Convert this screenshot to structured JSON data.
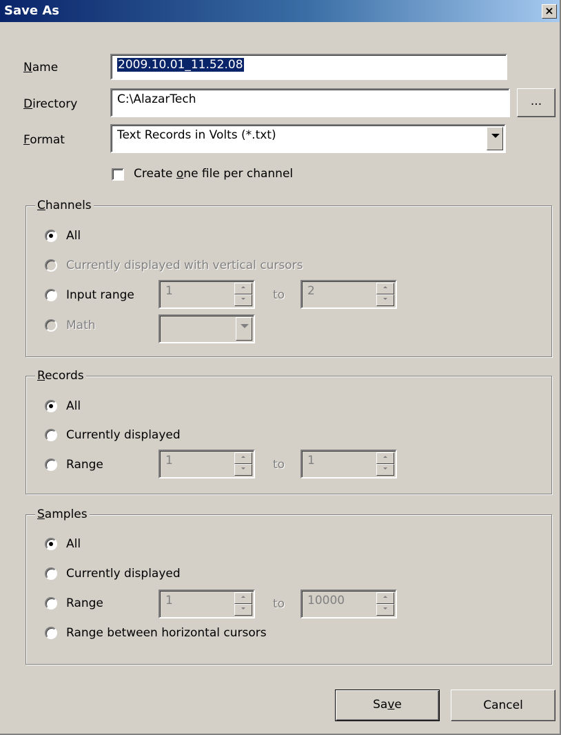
{
  "window": {
    "title": "Save As",
    "close_glyph": "×",
    "close_icon": "close-icon"
  },
  "name": {
    "label_key": "N",
    "label_rest": "ame",
    "value": "2009.10.01_11.52.08"
  },
  "directory": {
    "label_key": "D",
    "label_rest": "irectory",
    "value": "C:\\AlazarTech",
    "browse_label": "..."
  },
  "format": {
    "label_key": "F",
    "label_rest": "ormat",
    "value": "Text Records in Volts (*.txt)"
  },
  "one_file": {
    "pre": "Create ",
    "key": "o",
    "post": "ne file per channel",
    "checked": false
  },
  "channels": {
    "legend_key": "C",
    "legend_rest": "hannels",
    "all": "All",
    "current": "Currently displayed with vertical cursors",
    "input_range": "Input range",
    "math": "Math",
    "from": "1",
    "to_label": "to",
    "to": "2"
  },
  "records": {
    "legend_key": "R",
    "legend_rest": "ecords",
    "all": "All",
    "current": "Currently displayed",
    "range": "Range",
    "from": "1",
    "to_label": "to",
    "to": "1"
  },
  "samples": {
    "legend_key": "S",
    "legend_rest": "amples",
    "all": "All",
    "current": "Currently displayed",
    "range": "Range",
    "between": "Range between horizontal cursors",
    "from": "1",
    "to_label": "to",
    "to": "10000"
  },
  "buttons": {
    "save_pre": "Sa",
    "save_key": "v",
    "save_post": "e",
    "cancel": "Cancel"
  }
}
